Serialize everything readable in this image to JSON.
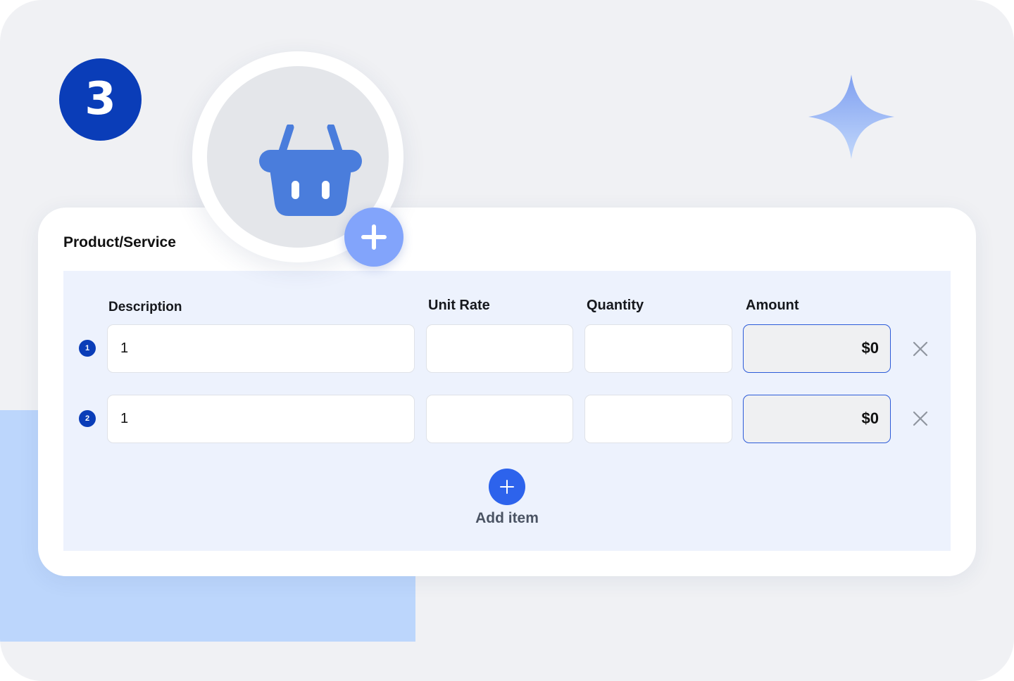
{
  "step": {
    "number": "3"
  },
  "section": {
    "title": "Product/Service"
  },
  "table": {
    "headers": {
      "description": "Description",
      "unit_rate": "Unit Rate",
      "quantity": "Quantity",
      "amount": "Amount"
    },
    "rows": [
      {
        "index": "1",
        "description": "1",
        "unit_rate": "",
        "quantity": "",
        "amount": "$0"
      },
      {
        "index": "2",
        "description": "1",
        "unit_rate": "",
        "quantity": "",
        "amount": "$0"
      }
    ]
  },
  "actions": {
    "add_item_label": "Add item"
  },
  "icons": {
    "basket": "shopping-basket-icon",
    "add": "plus-icon",
    "remove": "close-icon",
    "sparkle": "sparkle-icon"
  },
  "colors": {
    "brand_dark": "#0a3db8",
    "brand": "#2d63ec",
    "basket": "#4a7ddc",
    "light_accent": "#82a4fb",
    "panel": "#edf2fd"
  }
}
